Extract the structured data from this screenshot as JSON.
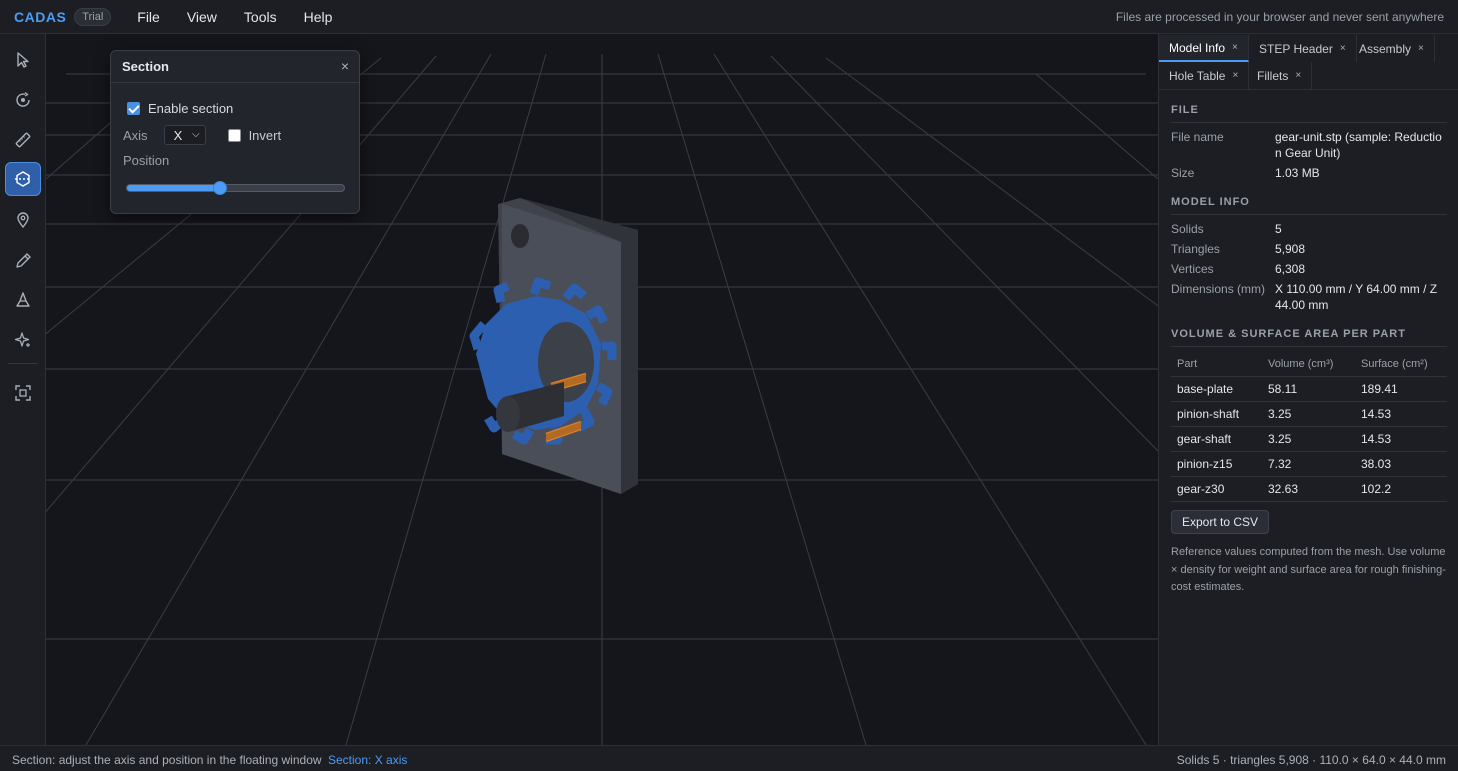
{
  "app": {
    "brand": "CADAS",
    "badge": "Trial",
    "privacy_note": "Files are processed in your browser and never sent anywhere"
  },
  "menu": [
    "File",
    "View",
    "Tools",
    "Help"
  ],
  "toolbar": [
    "select-tool",
    "orbit-tool",
    "measure-tool",
    "section-tool",
    "pin-tool",
    "pen-tool",
    "draft-tool",
    "magic-tool",
    "fit-view-tool"
  ],
  "section_window": {
    "title": "Section",
    "close": "×",
    "enable_label": "Enable section",
    "enable_checked": true,
    "axis_label": "Axis",
    "axis_value": "X",
    "invert_label": "Invert",
    "invert_checked": false,
    "position_label": "Position",
    "position_fraction": 0.43
  },
  "panel": {
    "tabs": [
      {
        "label": "Model Info",
        "active": true
      },
      {
        "label": "STEP Header",
        "active": false
      },
      {
        "label": "Assembly",
        "active": false
      },
      {
        "label": "Hole Table",
        "active": false
      },
      {
        "label": "Fillets",
        "active": false
      }
    ],
    "tab_close": "×",
    "file": {
      "heading": "FILE",
      "name_label": "File name",
      "name_value": "gear-unit.stp (sample: Reduction Gear Unit)",
      "size_label": "Size",
      "size_value": "1.03 MB"
    },
    "model_info": {
      "heading": "MODEL INFO",
      "solids_label": "Solids",
      "solids_value": "5",
      "triangles_label": "Triangles",
      "triangles_value": "5,908",
      "vertices_label": "Vertices",
      "vertices_value": "6,308",
      "dimensions_label": "Dimensions (mm)",
      "dimensions_value": "X 110.00 mm / Y 64.00 mm / Z 44.00 mm"
    },
    "volume": {
      "heading": "VOLUME & SURFACE AREA PER PART",
      "columns": [
        "Part",
        "Volume (cm³)",
        "Surface (cm²)"
      ],
      "rows": [
        [
          "base-plate",
          "58.11",
          "189.41"
        ],
        [
          "pinion-shaft",
          "3.25",
          "14.53"
        ],
        [
          "gear-shaft",
          "3.25",
          "14.53"
        ],
        [
          "pinion-z15",
          "7.32",
          "38.03"
        ],
        [
          "gear-z30",
          "32.63",
          "102.2"
        ]
      ]
    },
    "export_label": "Export to CSV",
    "note": "Reference values computed from the mesh. Use volume × density for weight and surface area for rough finishing-cost estimates."
  },
  "status": {
    "hint": "Section: adjust the axis and position in the floating window",
    "mode": "Section: X axis",
    "summary": "Solids 5 · triangles 5,908 · 110.0 × 64.0 × 44.0 mm"
  }
}
